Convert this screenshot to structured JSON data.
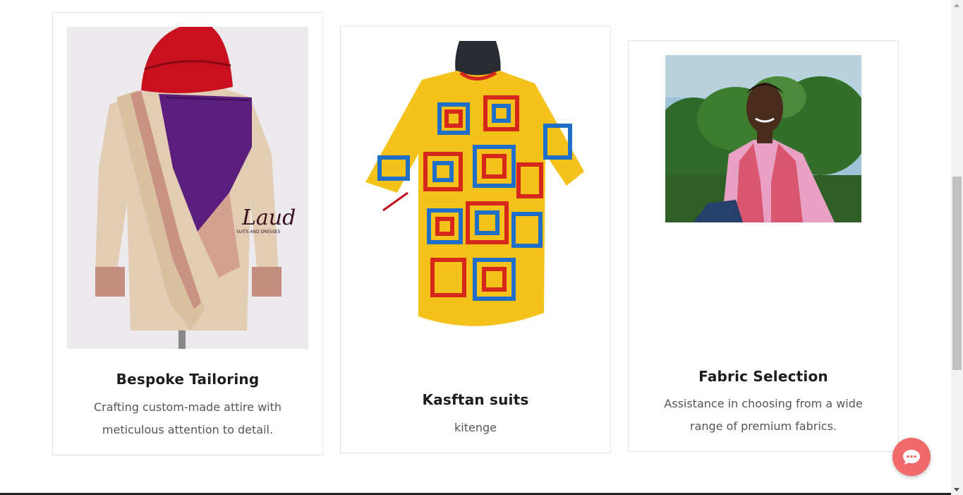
{
  "cards": [
    {
      "title": "Bespoke Tailoring",
      "desc": "Crafting custom-made attire with meticulous attention to detail.",
      "image_alt": "Beige tunic with purple panel and red fez",
      "watermark": "Laud",
      "watermark_sub": "SUITS AND DRESSES"
    },
    {
      "title": "Kasftan suits",
      "desc": "kitenge",
      "image_alt": "Colorful kitenge print shirt on mannequin"
    },
    {
      "title": "Fabric Selection",
      "desc": "Assistance in choosing from a wide range of premium fabrics.",
      "image_alt": "Man in pink waistcoat and striped shirt outdoors"
    }
  ],
  "chat": {
    "icon": "chat-bubble-icon",
    "color": "#f06a6a"
  }
}
